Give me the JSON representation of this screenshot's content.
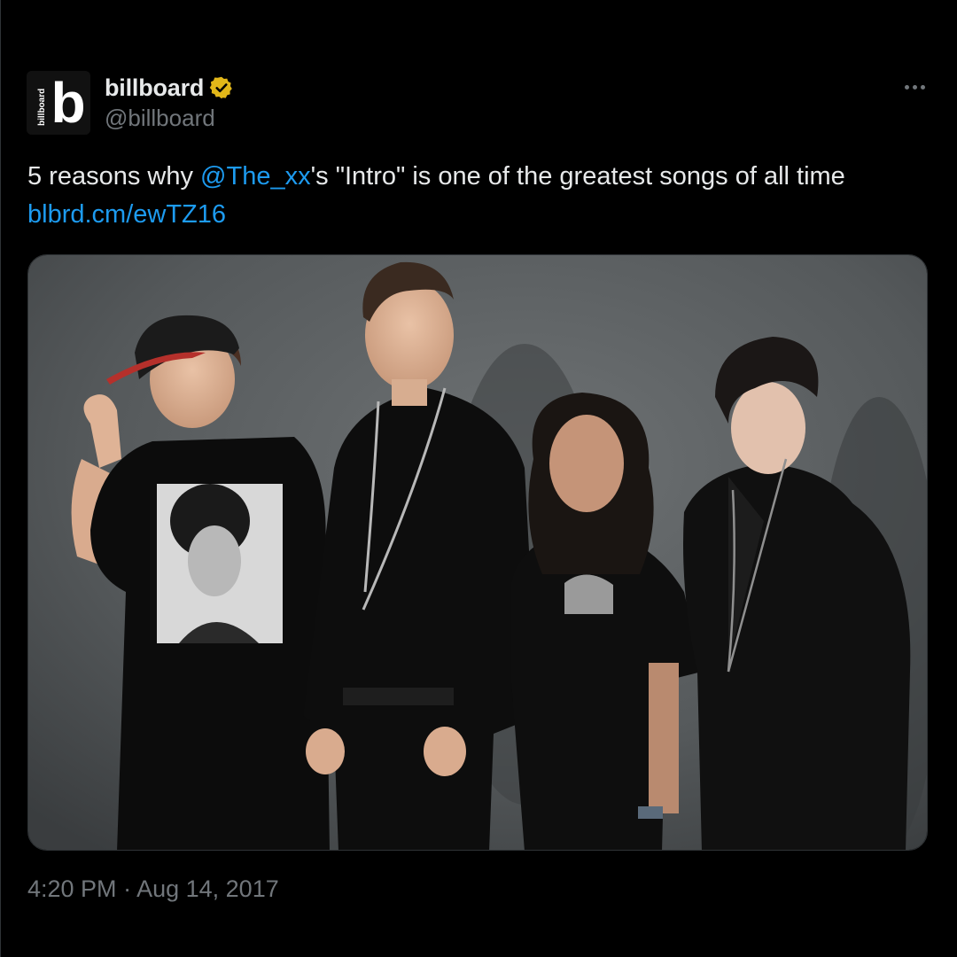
{
  "tweet": {
    "author": {
      "display_name": "billboard",
      "handle": "@billboard",
      "verified": true,
      "avatar_icon": "billboard-logo-icon",
      "avatar_logo_letter": "b",
      "avatar_logo_wordmark": "billboard"
    },
    "text": {
      "prefix": "5 reasons why ",
      "mention": "@The_xx",
      "suffix": "'s \"Intro\" is one of the greatest songs of all time",
      "link": "blbrd.cm/ewTZ16"
    },
    "media": {
      "type": "photo"
    },
    "time": "4:20 PM",
    "separator": " · ",
    "date": "Aug 14, 2017",
    "more_icon": "more-horizontal-icon",
    "colors": {
      "background": "#000000",
      "text": "#e7e9ea",
      "secondary": "#71767b",
      "link": "#1d9bf0",
      "verified_badge": "#e2b719"
    }
  }
}
